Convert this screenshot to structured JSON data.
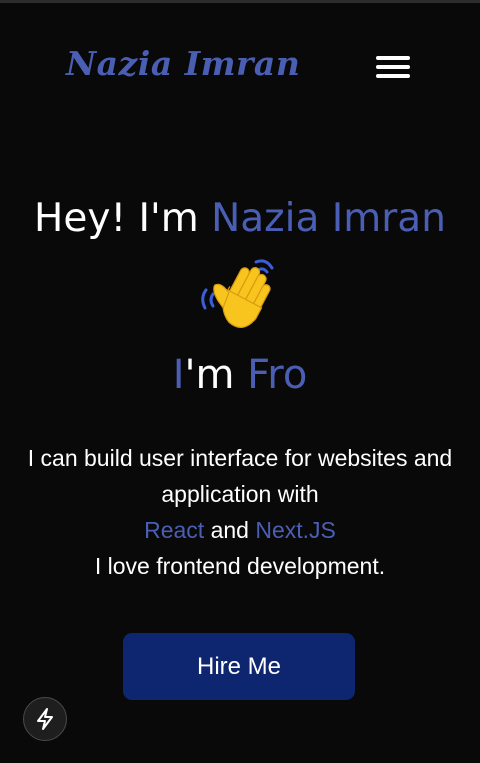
{
  "header": {
    "brand_name": "Nazia Imran",
    "menu_icon": "hamburger-menu-icon"
  },
  "hero": {
    "greeting_prefix": "Hey! I'm",
    "name": "Nazia Imran",
    "wave_icon": "waving-hand-icon",
    "typed_first_letter": "I",
    "typed_rest": "'m",
    "typed_partial_word": "Fro",
    "description_line_1": "I can build user interface for websites and",
    "description_line_2": "application with",
    "tech_1": "React",
    "tech_connector": "and",
    "tech_2": "Next.JS",
    "description_line_4": "I love frontend development.",
    "cta_label": "Hire Me"
  },
  "floating": {
    "bolt_icon": "lightning-bolt-icon"
  },
  "colors": {
    "background": "#0a0909",
    "accent": "#4a5fb4",
    "button": "#0e2570",
    "text": "#ffffff"
  }
}
